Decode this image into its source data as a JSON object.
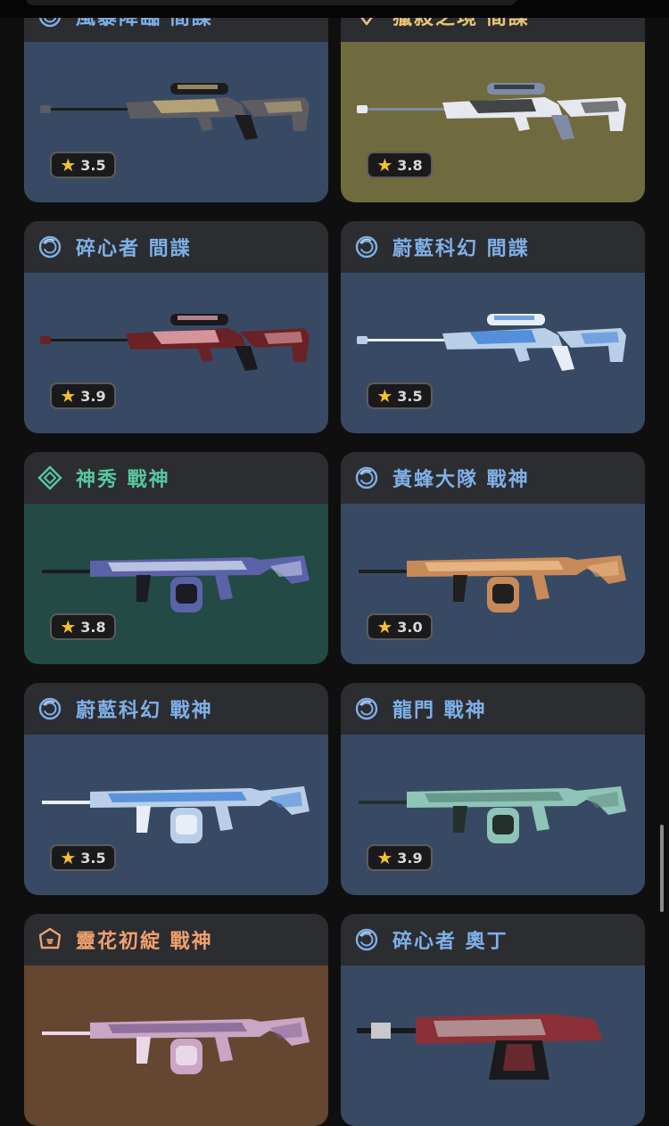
{
  "status_bar": {
    "label": ""
  },
  "cards": [
    {
      "title": "風暴降臨 間諜",
      "rating": "3.5",
      "tier": "deluxe",
      "title_color": "#7fb0e8",
      "bg": "#384a63",
      "gun": "sniper",
      "gun_colors": [
        "#5c5c62",
        "#c9b47a",
        "#1c1c1f"
      ]
    },
    {
      "title": "獵殺之境 間諜",
      "rating": "3.8",
      "tier": "exclusive",
      "title_color": "#e8c773",
      "bg": "#706a3f",
      "gun": "sniper",
      "gun_colors": [
        "#e6e8ef",
        "#1a1a1c",
        "#7e8ca8"
      ]
    },
    {
      "title": "碎心者 間諜",
      "rating": "3.9",
      "tier": "deluxe",
      "title_color": "#7fb0e8",
      "bg": "#384a63",
      "gun": "sniper",
      "gun_colors": [
        "#6b2226",
        "#f0b0b8",
        "#1a1a1c"
      ]
    },
    {
      "title": "蔚藍科幻 間諜",
      "rating": "3.5",
      "tier": "deluxe",
      "title_color": "#7fb0e8",
      "bg": "#384a63",
      "gun": "sniper",
      "gun_colors": [
        "#b9cfe8",
        "#3b7fd6",
        "#e8eef7"
      ]
    },
    {
      "title": "神秀 戰神",
      "rating": "3.8",
      "tier": "premium",
      "title_color": "#57c89f",
      "bg": "#234a44",
      "gun": "lmg",
      "gun_colors": [
        "#5a63a8",
        "#d9e0f4",
        "#1b1b24"
      ]
    },
    {
      "title": "黃蜂大隊 戰神",
      "rating": "3.0",
      "tier": "deluxe",
      "title_color": "#7fb0e8",
      "bg": "#384a63",
      "gun": "lmg",
      "gun_colors": [
        "#c88a58",
        "#f0c090",
        "#202020"
      ]
    },
    {
      "title": "蔚藍科幻 戰神",
      "rating": "3.5",
      "tier": "deluxe",
      "title_color": "#7fb0e8",
      "bg": "#384a63",
      "gun": "lmg",
      "gun_colors": [
        "#b9cfe8",
        "#3b7fd6",
        "#e8eef7"
      ]
    },
    {
      "title": "龍門 戰神",
      "rating": "3.9",
      "tier": "deluxe",
      "title_color": "#7fb0e8",
      "bg": "#384a63",
      "gun": "lmg",
      "gun_colors": [
        "#8fc4b8",
        "#5a8a7c",
        "#23302c"
      ]
    },
    {
      "title": "靈花初綻 戰神",
      "rating": "",
      "tier": "ultra",
      "title_color": "#f0a16e",
      "bg": "#654630",
      "gun": "lmg",
      "gun_colors": [
        "#c8a6c4",
        "#7e5f92",
        "#e8d8e8"
      ]
    },
    {
      "title": "碎心者 奧丁",
      "rating": "",
      "tier": "deluxe",
      "title_color": "#7fb0e8",
      "bg": "#384a63",
      "gun": "heavy",
      "gun_colors": [
        "#8a3036",
        "#c9c9c9",
        "#1a1a1c"
      ]
    }
  ]
}
